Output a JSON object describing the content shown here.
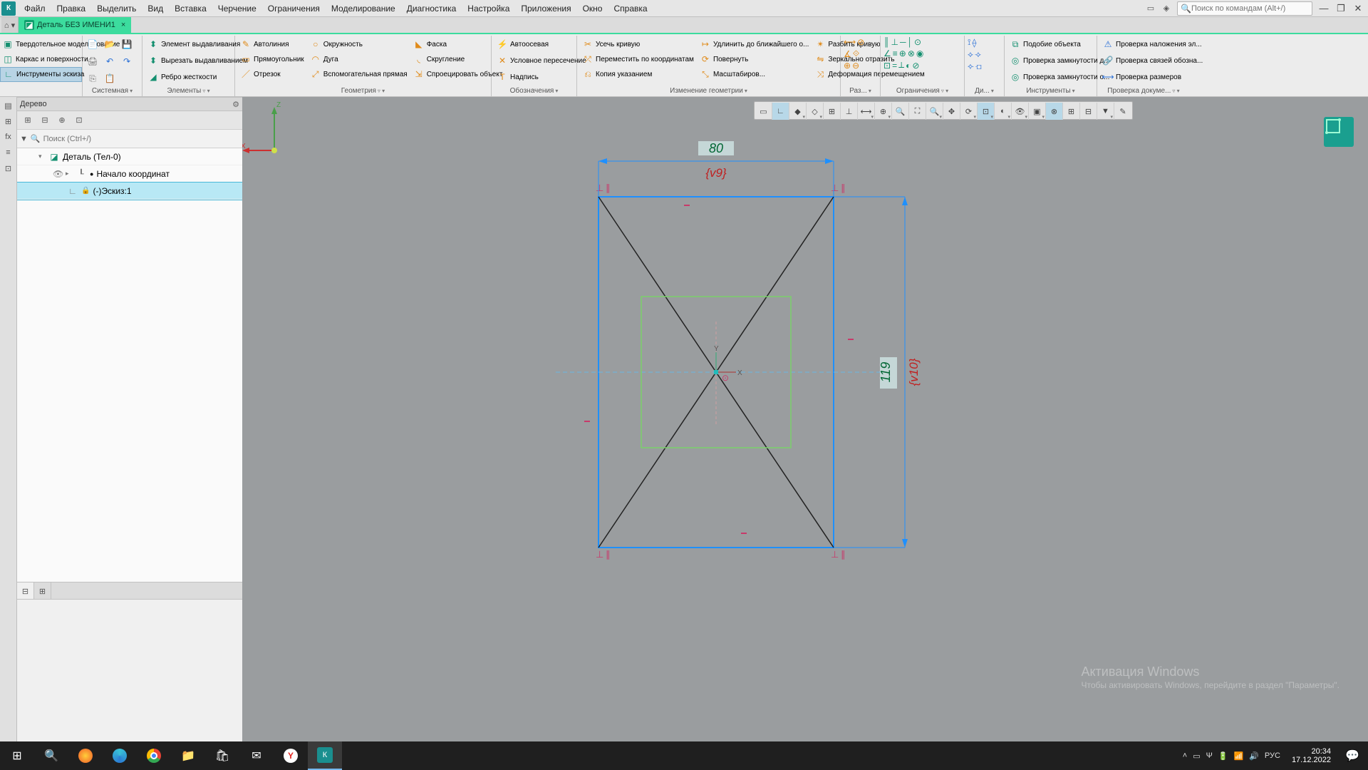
{
  "menubar": {
    "items": [
      "Файл",
      "Правка",
      "Выделить",
      "Вид",
      "Вставка",
      "Черчение",
      "Ограничения",
      "Моделирование",
      "Диагностика",
      "Настройка",
      "Приложения",
      "Окно",
      "Справка"
    ],
    "search_placeholder": "Поиск по командам (Alt+/)"
  },
  "tab": {
    "title": "Деталь БЕЗ ИМЕНИ1"
  },
  "ribbon": {
    "mode": {
      "items": [
        "Твердотельное моделирование",
        "Каркас и поверхности",
        "Инструменты эскиза"
      ]
    },
    "groups": {
      "system": "Системная",
      "elements": "Элементы",
      "geometry": "Геометрия",
      "annotation": "Обозначения",
      "modify": "Изменение геометрии",
      "size": "Раз...",
      "constraints": "Ограничения",
      "diag": "Ди...",
      "tools": "Инструменты",
      "check": "Проверка докуме..."
    },
    "elements_items": [
      "Элемент выдавливания",
      "Вырезать выдавливанием",
      "Ребро жесткости"
    ],
    "geometry_items": {
      "col1": [
        "Автолиния",
        "Прямоугольник",
        "Отрезок"
      ],
      "col2": [
        "Окружность",
        "Дуга",
        "Вспомогательная прямая"
      ],
      "col3": [
        "Фаска",
        "Скругление",
        "Спроецировать объект"
      ]
    },
    "annotation_items": [
      "Автоосевая",
      "Условное пересечение",
      "Надпись"
    ],
    "modify_items": {
      "col1": [
        "Усечь кривую",
        "Переместить по координатам",
        "Копия указанием"
      ],
      "col2": [
        "Удлинить до ближайшего о...",
        "Повернуть",
        "Масштабиров..."
      ],
      "col3": [
        "Разбить кривую",
        "Зеркально отразить",
        "Деформация перемещением"
      ]
    },
    "tools_items": [
      "Подобие объекта",
      "Проверка замкнутости д...",
      "Проверка замкнутости о..."
    ],
    "check_items": [
      "Проверка наложения эл...",
      "Проверка связей обозна...",
      "Проверка размеров"
    ]
  },
  "tree": {
    "title": "Дерево",
    "search_placeholder": "Поиск (Ctrl+/)",
    "nodes": {
      "root": "Деталь (Тел-0)",
      "origin": "Начало координат",
      "sketch": "(-)Эскиз:1"
    }
  },
  "sketch": {
    "dim_top": "80",
    "dim_top_var": "{v9}",
    "dim_right": "119",
    "dim_right_var": "{v10}",
    "axis_x": "X",
    "axis_y": "Y",
    "axis_z": "Z"
  },
  "watermark": {
    "l1": "Активация Windows",
    "l2": "Чтобы активировать Windows, перейдите в раздел \"Параметры\"."
  },
  "taskbar": {
    "lang": "РУС",
    "time": "20:34",
    "date": "17.12.2022"
  }
}
